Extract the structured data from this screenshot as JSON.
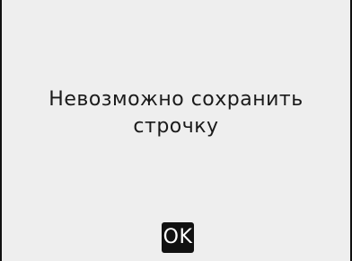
{
  "dialog": {
    "message_line1": "Невозможно сохранить",
    "message_line2": "строчку",
    "ok_label": "OK"
  },
  "colors": {
    "background": "#eeeeee",
    "text": "#1a1a1a",
    "button_bg": "#111111",
    "button_text": "#ffffff",
    "border": "#111111"
  }
}
